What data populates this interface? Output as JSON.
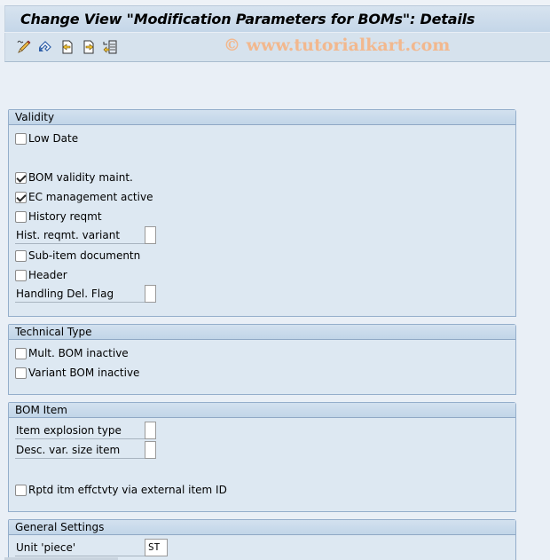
{
  "window": {
    "title": "Change View \"Modification Parameters for BOMs\": Details",
    "watermark": "© www.tutorialkart.com"
  },
  "toolbar": {
    "buttons": [
      {
        "name": "display-change-icon",
        "tooltip": "Display/Change"
      },
      {
        "name": "undo-icon",
        "tooltip": "Undo"
      },
      {
        "name": "previous-entry-icon",
        "tooltip": "Previous Entry"
      },
      {
        "name": "next-entry-icon",
        "tooltip": "Next Entry"
      },
      {
        "name": "variable-list-icon",
        "tooltip": "Variable List"
      }
    ]
  },
  "groups": {
    "validity": {
      "title": "Validity",
      "low_date": {
        "label": "Low Date",
        "checked": false
      },
      "bom_validity_maint": {
        "label": "BOM validity maint.",
        "checked": true
      },
      "ec_management_active": {
        "label": "EC management active",
        "checked": true
      },
      "history_reqmt": {
        "label": "History reqmt",
        "checked": false
      },
      "hist_reqmt_variant": {
        "label": "Hist. reqmt. variant",
        "value": ""
      },
      "sub_item_documentn": {
        "label": "Sub-item documentn",
        "checked": false
      },
      "header": {
        "label": "Header",
        "checked": false
      },
      "handling_del_flag": {
        "label": "Handling Del. Flag",
        "value": ""
      }
    },
    "technical_type": {
      "title": "Technical Type",
      "mult_bom_inactive": {
        "label": "Mult. BOM inactive",
        "checked": false
      },
      "variant_bom_inactive": {
        "label": "Variant BOM inactive",
        "checked": false
      }
    },
    "bom_item": {
      "title": "BOM Item",
      "item_explosion_type": {
        "label": "Item explosion type",
        "value": ""
      },
      "desc_var_size_item": {
        "label": "Desc. var. size item",
        "value": ""
      },
      "rptd_itm_effctvty": {
        "label": "Rptd itm effctvty via external item ID",
        "checked": false
      }
    },
    "general_settings": {
      "title": "General Settings",
      "unit_piece": {
        "label": "Unit 'piece'",
        "value": "ST"
      }
    }
  }
}
